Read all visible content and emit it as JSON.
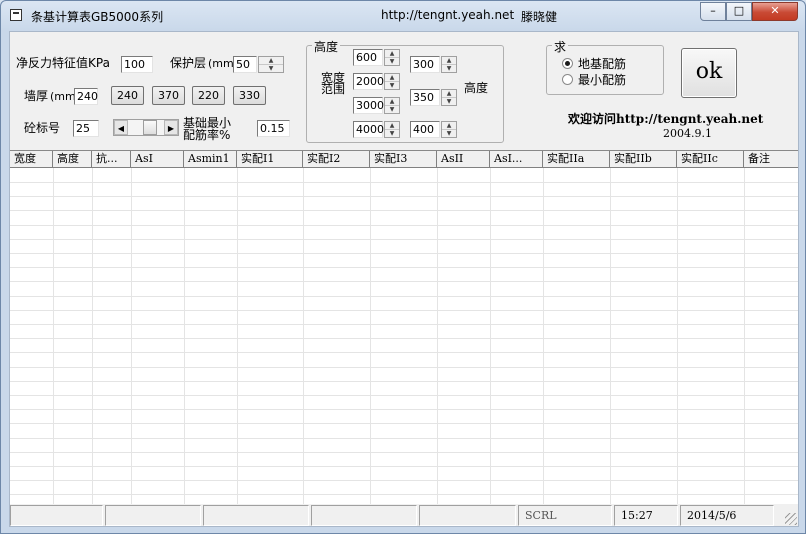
{
  "window": {
    "title": "条基计算表GB5000系列",
    "url": "http://tengnt.yeah.net",
    "author": "滕晓健",
    "min_glyph": "–",
    "max_glyph": "□",
    "close_glyph": "✕"
  },
  "form": {
    "net_reaction_label": "净反力特征值KPa",
    "net_reaction_value": "100",
    "cover_label": "保护层",
    "cover_unit": "(mm)",
    "cover_value": "50",
    "wall_label": "墙厚",
    "wall_unit": "(mm)",
    "wall_value": "240",
    "wall_presets": [
      "240",
      "370",
      "220",
      "330"
    ],
    "concrete_label": "砼标号",
    "concrete_value": "25",
    "min_ratio_label_1": "基础最小",
    "min_ratio_label_2": "配筋率%",
    "min_ratio_value": "0.15"
  },
  "ranges": {
    "height_label": "高度",
    "width_label_1": "宽度",
    "width_label_2": "范围",
    "height_label_right": "高度",
    "width_values": [
      "600",
      "2000",
      "3000",
      "4000"
    ],
    "height_values": [
      "300",
      "350",
      "400"
    ]
  },
  "mode": {
    "group_title": "求",
    "option_1": "地基配筋",
    "option_2": "最小配筋",
    "selected": "地基配筋"
  },
  "ok_label": "ok",
  "welcome_text": "欢迎访问http://tengnt.yeah.net",
  "date_text": "2004.9.1",
  "grid": {
    "columns": [
      "宽度",
      "高度",
      "抗...",
      "AsI",
      "Asmin1",
      "实配I1",
      "实配I2",
      "实配I3",
      "AsII",
      "AsI...",
      "实配IIa",
      "实配IIb",
      "实配IIc",
      "备注"
    ]
  },
  "statusbar": {
    "panels": [
      "",
      "",
      "",
      "",
      "",
      "SCRL",
      "15:27",
      "2014/5/6"
    ]
  }
}
